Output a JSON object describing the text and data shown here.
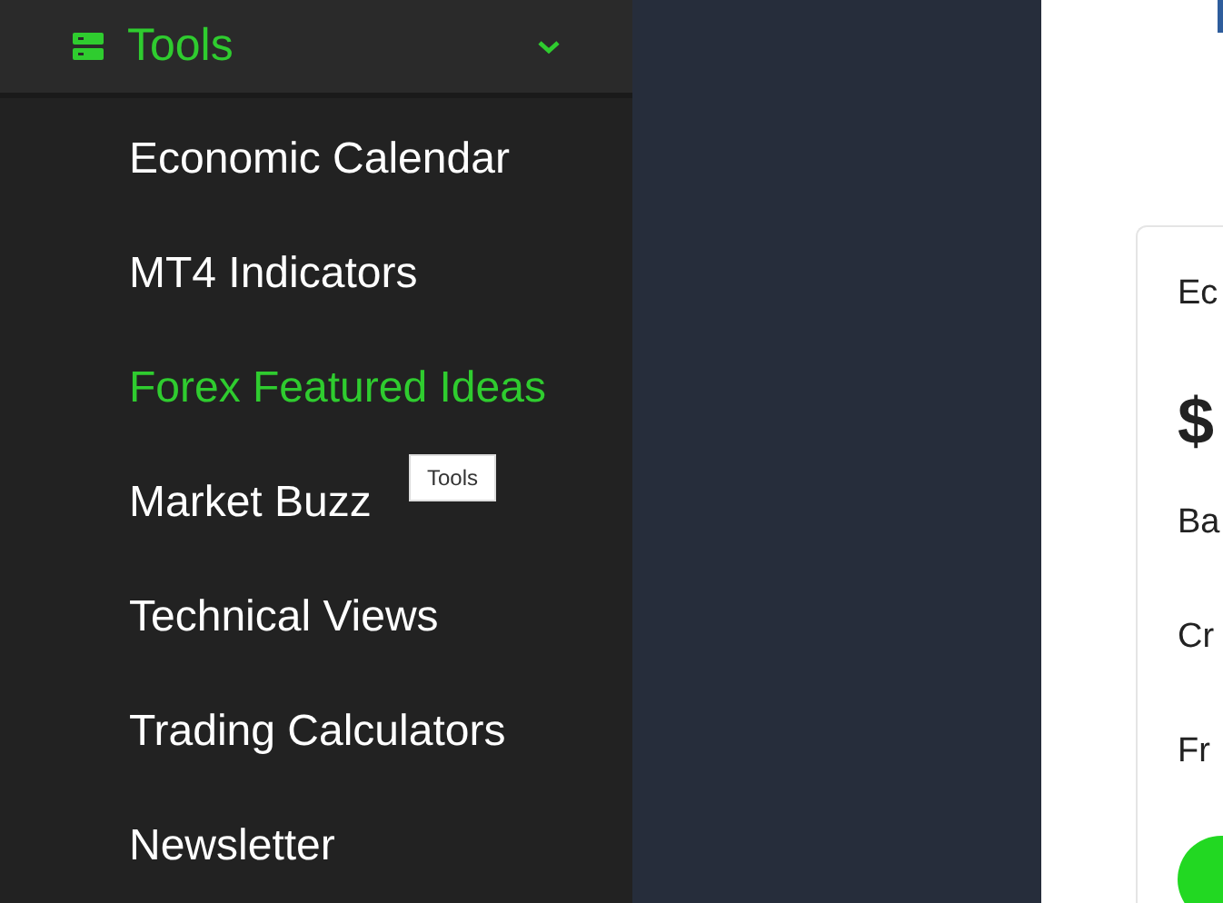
{
  "sidebar": {
    "section": {
      "label": "Tools",
      "expanded": true
    },
    "items": [
      {
        "label": "Economic Calendar",
        "selected": false
      },
      {
        "label": "MT4 Indicators",
        "selected": false
      },
      {
        "label": "Forex Featured Ideas",
        "selected": true
      },
      {
        "label": "Market Buzz",
        "selected": false
      },
      {
        "label": "Technical Views",
        "selected": false
      },
      {
        "label": "Trading Calculators",
        "selected": false
      },
      {
        "label": "Newsletter",
        "selected": false
      }
    ]
  },
  "tooltip": "Tools",
  "card": {
    "lines": [
      {
        "kind": "text",
        "text": "Ec"
      },
      {
        "kind": "amount",
        "text": "$"
      },
      {
        "kind": "text",
        "text": "Ba"
      },
      {
        "kind": "text",
        "text": "Cr"
      },
      {
        "kind": "text",
        "text": "Fr"
      }
    ]
  }
}
